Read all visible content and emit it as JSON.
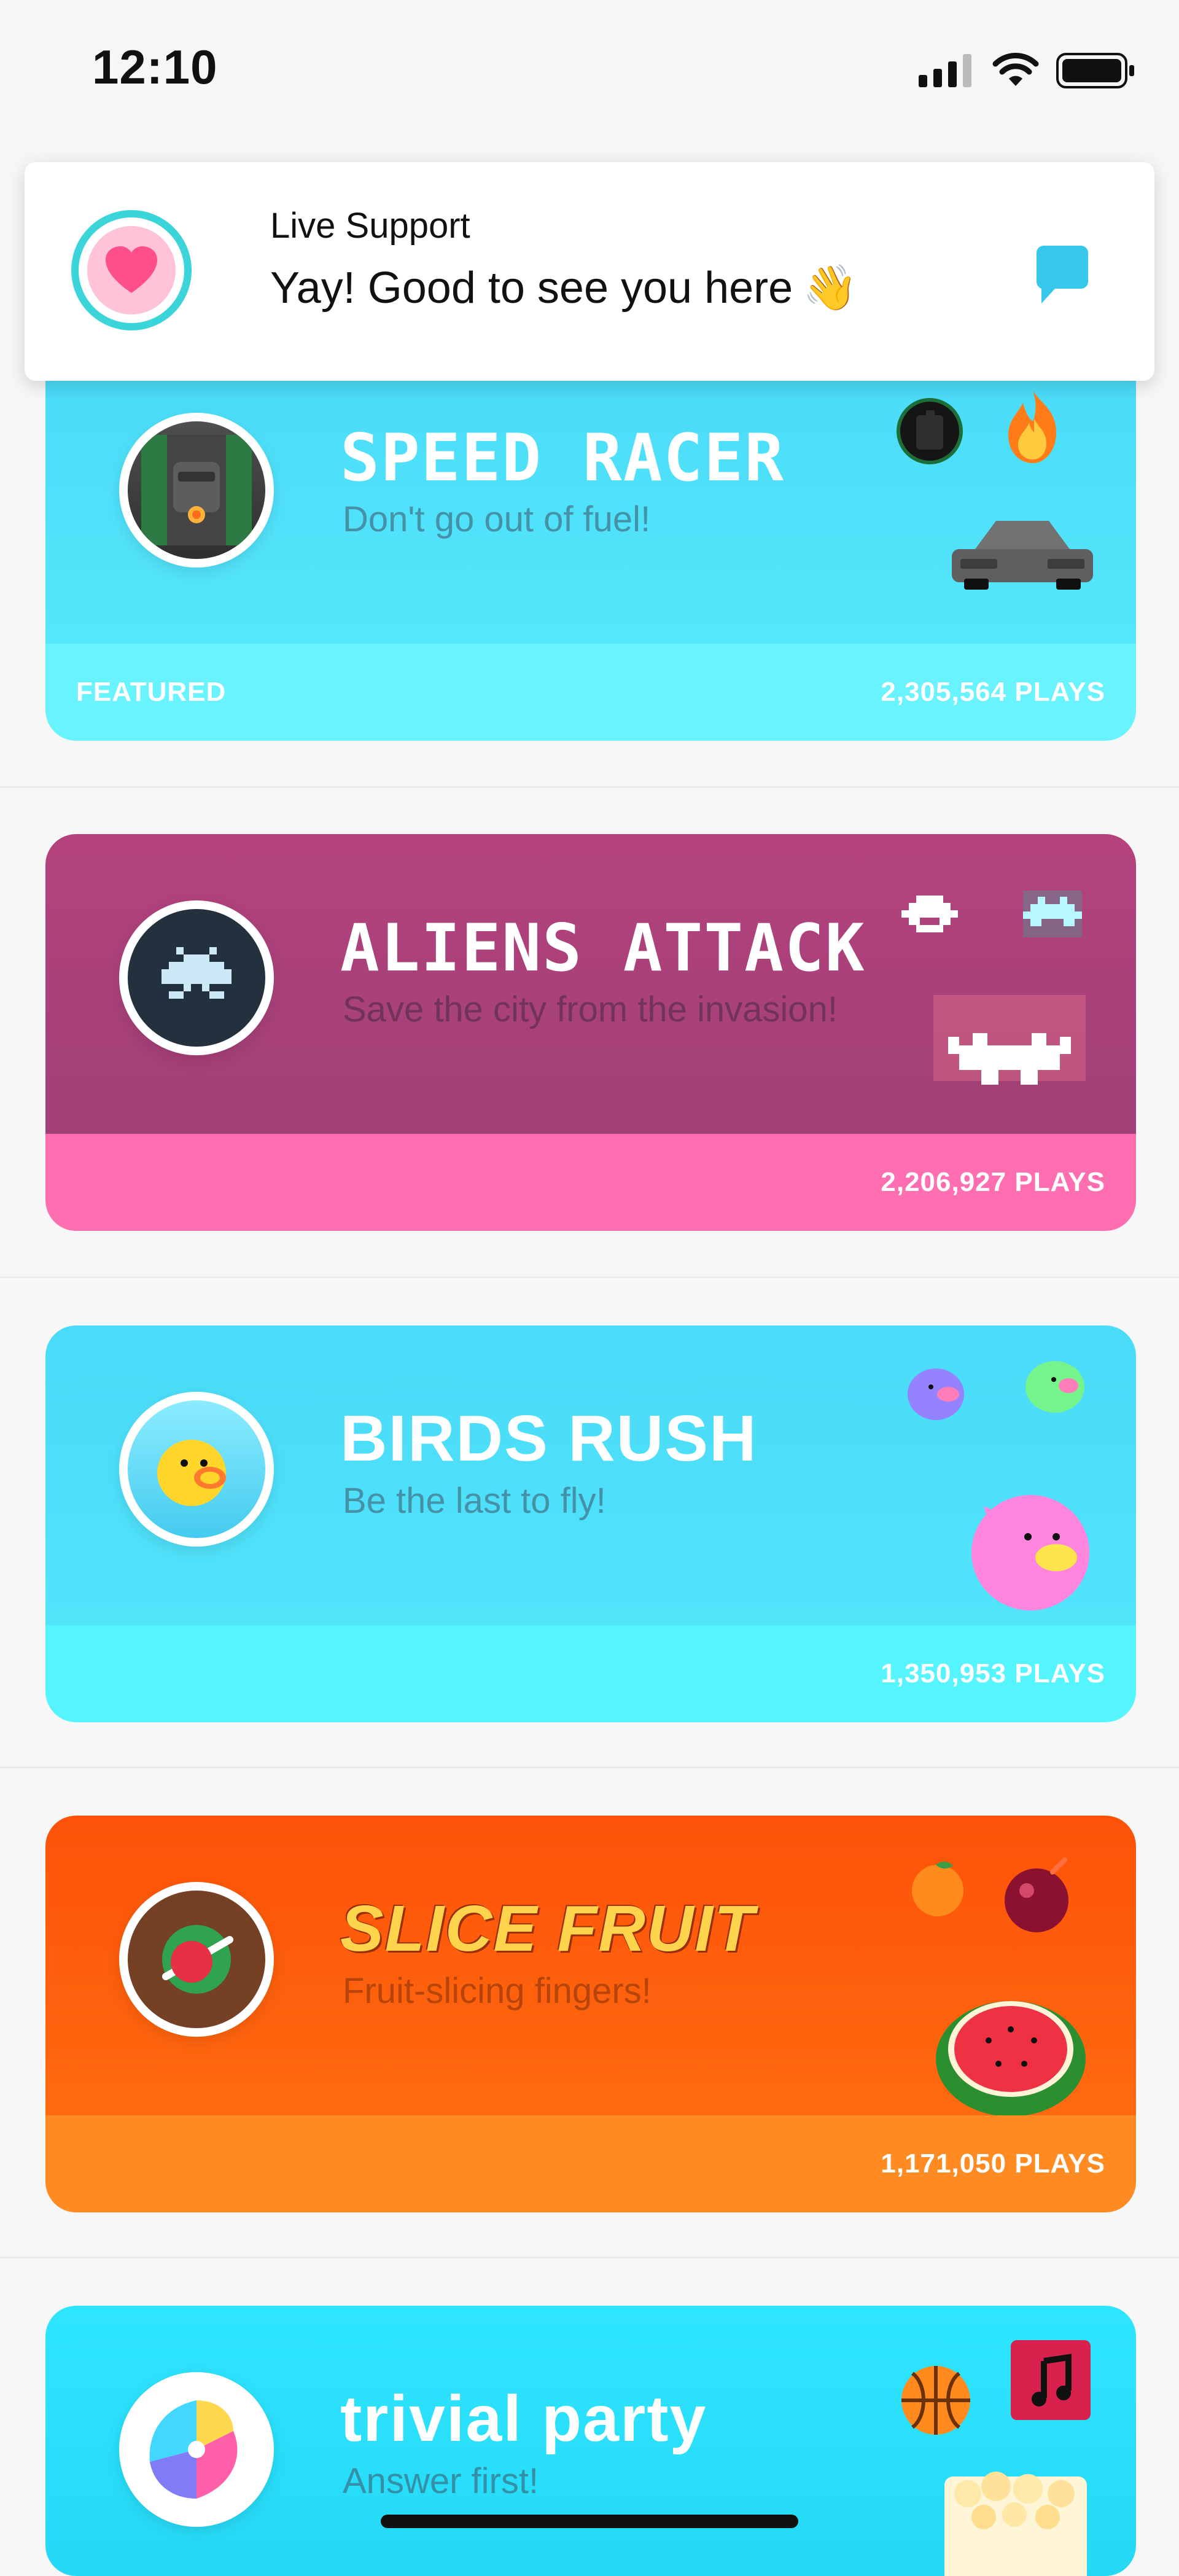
{
  "status_bar": {
    "time": "12:10"
  },
  "toast": {
    "title": "Live Support",
    "message": "Yay! Good to see you here",
    "emoji": "👋"
  },
  "games": [
    {
      "title": "SPEED RACER",
      "subtitle": "Don't go out of fuel!",
      "badge": "FEATURED",
      "plays": "2,305,564 PLAYS"
    },
    {
      "title": "ALIENS ATTACK",
      "subtitle": "Save the city from the invasion!",
      "plays": "2,206,927 PLAYS"
    },
    {
      "title": "BIRDS RUSH",
      "subtitle": "Be the last to fly!",
      "plays": "1,350,953 PLAYS"
    },
    {
      "title": "SLICE FRUIT",
      "subtitle": "Fruit-slicing fingers!",
      "plays": "1,171,050 PLAYS"
    },
    {
      "title": "trivial party",
      "subtitle": "Answer first!"
    }
  ],
  "colors": {
    "cyan_card": "#49dbf8",
    "aliens_card": "#b4427d",
    "aliens_footer": "#ff6eb0",
    "fruit_card": "#fd5208",
    "fruit_footer": "#ff8b22",
    "accent": "#3ad4d9"
  }
}
